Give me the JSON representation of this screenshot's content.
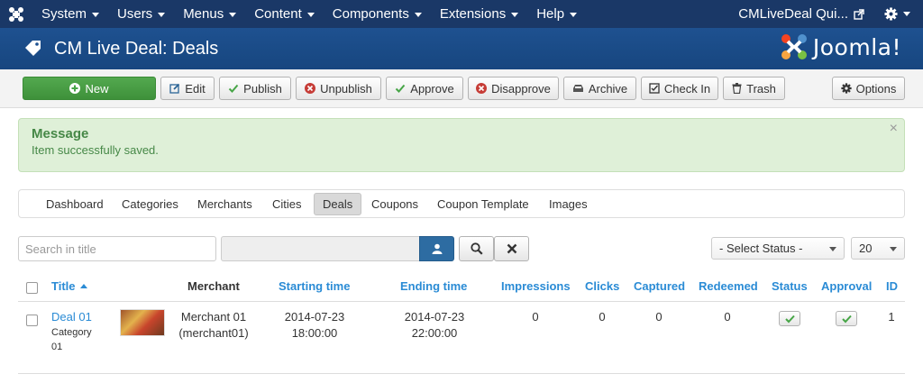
{
  "navbar": {
    "menus": [
      {
        "label": "System"
      },
      {
        "label": "Users"
      },
      {
        "label": "Menus"
      },
      {
        "label": "Content"
      },
      {
        "label": "Components"
      },
      {
        "label": "Extensions"
      },
      {
        "label": "Help"
      }
    ],
    "site_name": "CMLiveDeal Qui...",
    "icons": {
      "logo": "joomla-logo-icon",
      "external": "external-link-icon",
      "settings": "gear-icon"
    }
  },
  "header": {
    "title": "CM Live Deal: Deals",
    "brand": "Joomla!",
    "icon": "tag-icon"
  },
  "toolbar": {
    "new_label": "New",
    "edit_label": "Edit",
    "publish_label": "Publish",
    "unpublish_label": "Unpublish",
    "approve_label": "Approve",
    "disapprove_label": "Disapprove",
    "archive_label": "Archive",
    "checkin_label": "Check In",
    "trash_label": "Trash",
    "options_label": "Options"
  },
  "message": {
    "heading": "Message",
    "text": "Item successfully saved.",
    "close": "×"
  },
  "submenu": {
    "items": [
      {
        "label": "Dashboard"
      },
      {
        "label": "Categories"
      },
      {
        "label": "Merchants"
      },
      {
        "label": "Cities"
      },
      {
        "label": "Deals"
      },
      {
        "label": "Coupons"
      },
      {
        "label": "Coupon Template"
      },
      {
        "label": "Images"
      }
    ],
    "active": "Deals"
  },
  "filters": {
    "search_placeholder": "Search in title",
    "status_select": "- Select Status -",
    "limit_select": "20"
  },
  "table": {
    "headers": {
      "title": "Title",
      "merchant": "Merchant",
      "starting_time": "Starting time",
      "ending_time": "Ending time",
      "impressions": "Impressions",
      "clicks": "Clicks",
      "captured": "Captured",
      "redeemed": "Redeemed",
      "status": "Status",
      "approval": "Approval",
      "id": "ID"
    },
    "rows": [
      {
        "title": "Deal 01",
        "category_line1": "Category",
        "category_line2": "01",
        "merchant_line1": "Merchant 01",
        "merchant_line2": "(merchant01)",
        "start_date": "2014-07-23",
        "start_time": "18:00:00",
        "end_date": "2014-07-23",
        "end_time": "22:00:00",
        "impressions": "0",
        "clicks": "0",
        "captured": "0",
        "redeemed": "0",
        "id": "1"
      }
    ]
  },
  "colors": {
    "navbar": "#1a3867",
    "header": "#1e5190",
    "link": "#2a8bd5",
    "success": "#468847",
    "new_button": "#46a546"
  }
}
